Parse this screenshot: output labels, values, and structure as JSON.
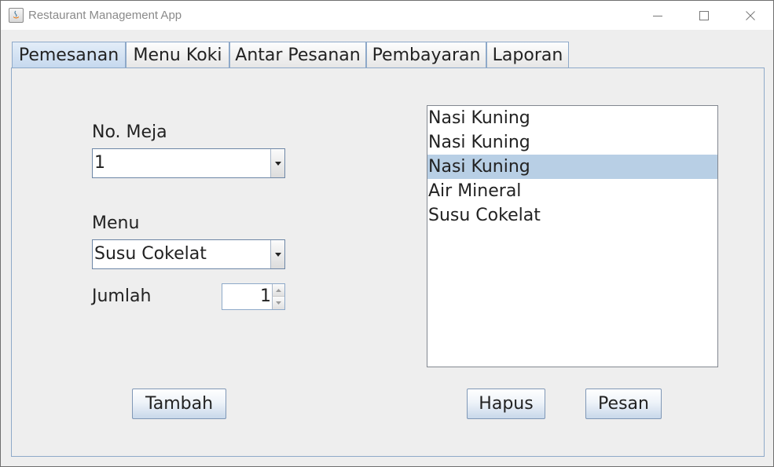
{
  "window": {
    "title": "Restaurant Management App"
  },
  "tabs": [
    {
      "label": "Pemesanan",
      "selected": true
    },
    {
      "label": "Menu Koki",
      "selected": false
    },
    {
      "label": "Antar Pesanan",
      "selected": false
    },
    {
      "label": "Pembayaran",
      "selected": false
    },
    {
      "label": "Laporan",
      "selected": false
    }
  ],
  "form": {
    "table_label": "No. Meja",
    "table_value": "1",
    "menu_label": "Menu",
    "menu_value": "Susu Cokelat",
    "qty_label": "Jumlah",
    "qty_value": "1",
    "add_button": "Tambah"
  },
  "order_list": {
    "items": [
      "Nasi Kuning",
      "Nasi Kuning",
      "Nasi Kuning",
      "Air Mineral",
      "Susu Cokelat"
    ],
    "selected_index": 2
  },
  "actions": {
    "delete_button": "Hapus",
    "order_button": "Pesan"
  },
  "colors": {
    "selected_tab": "#c5d8ee",
    "list_selection": "#b8cfe5",
    "border_accent": "#8ea9c9"
  }
}
